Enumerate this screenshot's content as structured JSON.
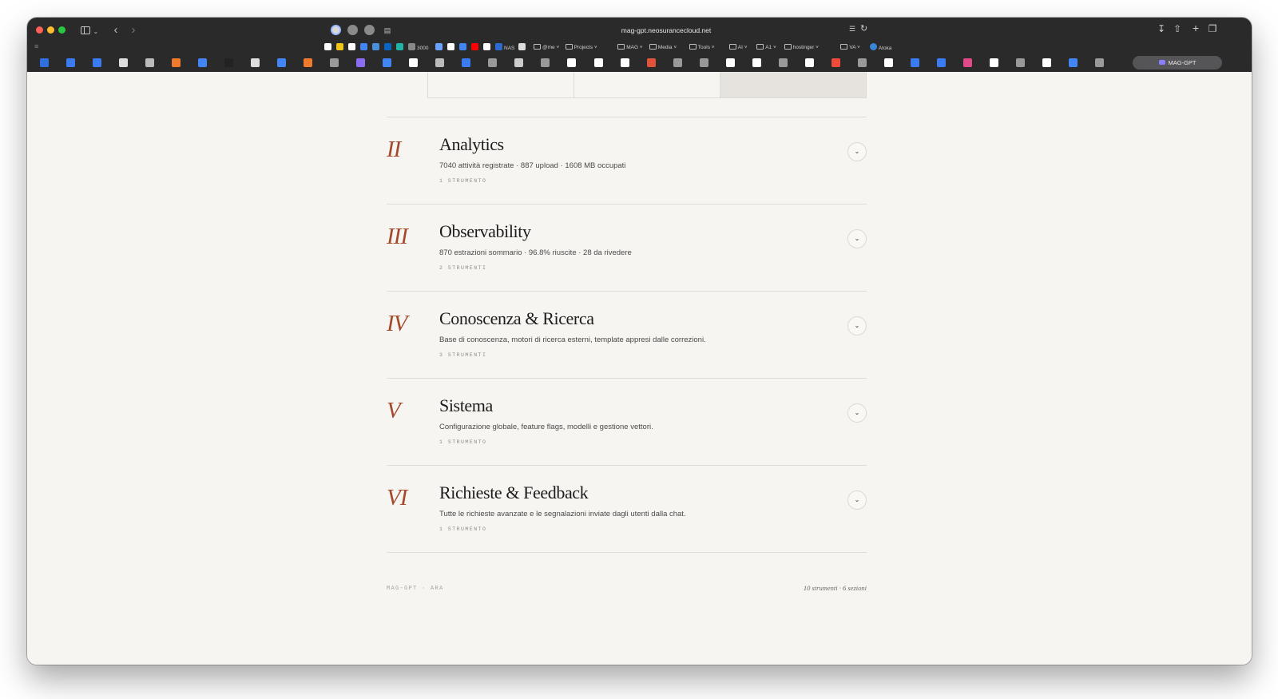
{
  "browser": {
    "url": "mag-gpt.neosurancecloud.net",
    "active_tab_label": "MAG-GPT",
    "bookmarks": [
      {
        "label": "",
        "color": "#ffffff"
      },
      {
        "label": "",
        "color": "#f0c419"
      },
      {
        "label": "",
        "color": "#ffffff"
      },
      {
        "label": "",
        "color": "#4285f4"
      },
      {
        "label": "",
        "color": "#4a90d9"
      },
      {
        "label": "",
        "color": "#0a66c2"
      },
      {
        "label": "",
        "color": "#21b3a7"
      },
      {
        "label": "3000",
        "color": "#888888"
      },
      {
        "label": "",
        "color": "#6aa3ff"
      },
      {
        "label": "",
        "color": "#ffffff"
      },
      {
        "label": "",
        "color": "#4285f4"
      },
      {
        "label": "",
        "color": "#ff0000"
      },
      {
        "label": "",
        "color": "#ffffff"
      },
      {
        "label": "NAS",
        "color": "#2d6bd1"
      },
      {
        "label": "",
        "color": "#dddddd"
      }
    ],
    "bookmark_folders": [
      "@me",
      "Projects",
      "MAG",
      "Media",
      "Tools",
      "AI",
      "A1",
      "hostinger",
      "VA"
    ],
    "bookmark_last": "Atoka"
  },
  "page": {
    "sections": [
      {
        "numeral": "II",
        "title": "Analytics",
        "description": "7040 attività registrate · 887 upload · 1608 MB occupati",
        "count": "1 STRUMENTO"
      },
      {
        "numeral": "III",
        "title": "Observability",
        "description": "870 estrazioni sommario · 96.8% riuscite · 28 da rivedere",
        "count": "2 STRUMENTI"
      },
      {
        "numeral": "IV",
        "title": "Conoscenza & Ricerca",
        "description": "Base di conoscenza, motori di ricerca esterni, template appresi dalle correzioni.",
        "count": "3 STRUMENTI"
      },
      {
        "numeral": "V",
        "title": "Sistema",
        "description": "Configurazione globale, feature flags, modelli e gestione vettori.",
        "count": "1 STRUMENTO"
      },
      {
        "numeral": "VI",
        "title": "Richieste & Feedback",
        "description": "Tutte le richieste avanzate e le segnalazioni inviate dagli utenti dalla chat.",
        "count": "1 STRUMENTO"
      }
    ],
    "footer_left": "MAG-GPT · ARA",
    "footer_right": "10 strumenti · 6 sezioni"
  }
}
